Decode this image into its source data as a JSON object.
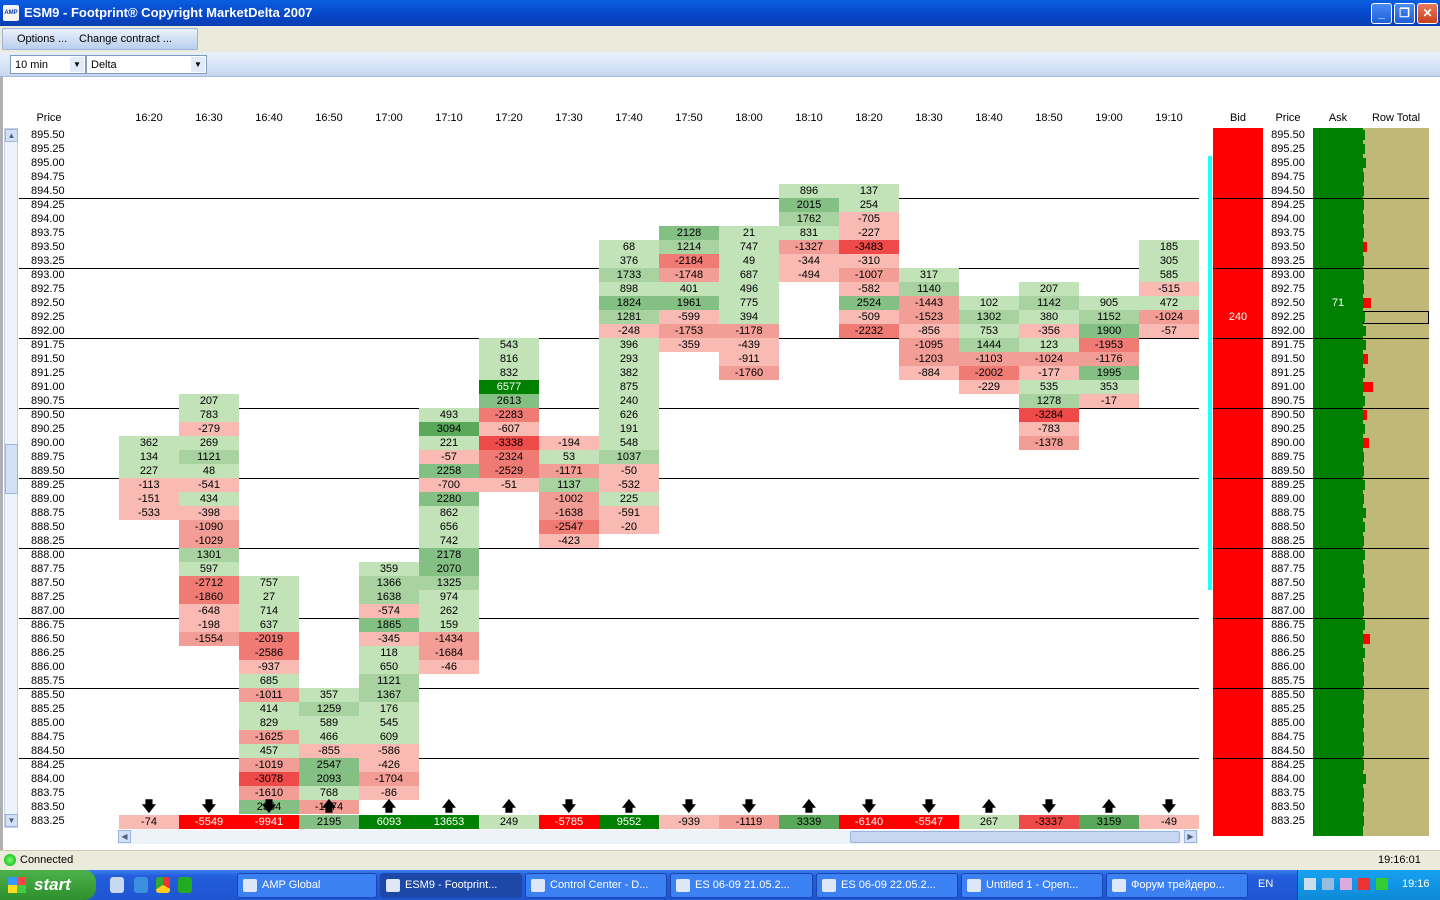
{
  "window": {
    "title": "ESM9 - Footprint® Copyright MarketDelta 2007",
    "app_icon": "AMP",
    "controls": [
      "minimize-icon",
      "restore-icon",
      "close-icon"
    ]
  },
  "toolbar": {
    "options_label": "Options ...",
    "change_contract_label": "Change contract ..."
  },
  "selectors": {
    "timeframe": "10 min",
    "mode": "Delta"
  },
  "chart": {
    "price_header": "Price",
    "times": [
      "16:20",
      "16:30",
      "16:40",
      "16:50",
      "17:00",
      "17:10",
      "17:20",
      "17:30",
      "17:40",
      "17:50",
      "18:00",
      "18:10",
      "18:20",
      "18:30",
      "18:40",
      "18:50",
      "19:00",
      "19:10"
    ],
    "prices": [
      "895.50",
      "895.25",
      "895.00",
      "894.75",
      "894.50",
      "894.25",
      "894.00",
      "893.75",
      "893.50",
      "893.25",
      "893.00",
      "892.75",
      "892.50",
      "892.25",
      "892.00",
      "891.75",
      "891.50",
      "891.25",
      "891.00",
      "890.75",
      "890.50",
      "890.25",
      "890.00",
      "889.75",
      "889.50",
      "889.25",
      "889.00",
      "888.75",
      "888.50",
      "888.25",
      "888.00",
      "887.75",
      "887.50",
      "887.25",
      "887.00",
      "886.75",
      "886.50",
      "886.25",
      "886.00",
      "885.75",
      "885.50",
      "885.25",
      "885.00",
      "884.75",
      "884.50",
      "884.25",
      "884.00",
      "883.75",
      "883.50",
      "883.25"
    ],
    "columns": [
      {
        "start": "890.00",
        "cells": [
          "362",
          "134",
          "227",
          "-113",
          "-151",
          "-533"
        ]
      },
      {
        "start": "890.75",
        "cells": [
          "207",
          "783",
          "-279",
          "269",
          "1121",
          "48",
          "-541",
          "434",
          "-398",
          "-1090",
          "-1029",
          "1301",
          "597",
          "-2712",
          "-1860",
          "-648",
          "-198",
          "-1554"
        ]
      },
      {
        "start": "887.50",
        "cells": [
          "757",
          "27",
          "714",
          "637",
          "-2019",
          "-2586",
          "-937",
          "685",
          "-1011",
          "414",
          "829",
          "-1625",
          "457",
          "-1019",
          "-3078",
          "-1610",
          "2354"
        ]
      },
      {
        "start": "885.50",
        "cells": [
          "357",
          "1259",
          "589",
          "466",
          "-855",
          "2547",
          "2093",
          "768",
          "-1674"
        ]
      },
      {
        "start": "887.75",
        "cells": [
          "359",
          "1366",
          "1638",
          "-574",
          "1865",
          "-345",
          "118",
          "650",
          "1121",
          "1367",
          "176",
          "545",
          "609",
          "-586",
          "-426",
          "-1704",
          "-86"
        ]
      },
      {
        "start": "890.50",
        "cells": [
          "493",
          "3094",
          "221",
          "-57",
          "2258",
          "-700",
          "2280",
          "862",
          "656",
          "742",
          "2178",
          "2070",
          "1325",
          "974",
          "262",
          "159",
          "-1434",
          "-1684",
          "-46"
        ]
      },
      {
        "start": "891.75",
        "cells": [
          "543",
          "816",
          "832",
          "6577",
          "2613",
          "-2283",
          "-607",
          "-3338",
          "-2324",
          "-2529",
          "-51"
        ]
      },
      {
        "start": "890.00",
        "cells": [
          "-194",
          "53",
          "-1171",
          "1137",
          "-1002",
          "-1638",
          "-2547",
          "-423"
        ]
      },
      {
        "start": "893.50",
        "cells": [
          "68",
          "376",
          "1733",
          "898",
          "1824",
          "1281",
          "-248",
          "396",
          "293",
          "382",
          "875",
          "240",
          "626",
          "191",
          "548",
          "1037",
          "-50",
          "-532",
          "225",
          "-591",
          "-20"
        ]
      },
      {
        "start": "893.75",
        "cells": [
          "2128",
          "1214",
          "-2184",
          "-1748",
          "401",
          "1961",
          "-599",
          "-1753",
          "-359"
        ]
      },
      {
        "start": "893.75",
        "cells": [
          "21",
          "747",
          "49",
          "687",
          "496",
          "775",
          "394",
          "-1178",
          "-439",
          "-911",
          "-1760"
        ]
      },
      {
        "start": "894.50",
        "cells": [
          "896",
          "2015",
          "1762",
          "831",
          "-1327",
          "-344",
          "-494"
        ]
      },
      {
        "start": "894.50",
        "cells": [
          "137",
          "254",
          "-705",
          "-227",
          "-3483",
          "-310",
          "-1007",
          "-582",
          "2524",
          "-509",
          "-2232"
        ]
      },
      {
        "start": "893.00",
        "cells": [
          "317",
          "1140",
          "-1443",
          "-1523",
          "-856",
          "-1095",
          "-1203",
          "-884"
        ]
      },
      {
        "start": "892.50",
        "cells": [
          "102",
          "1302",
          "753",
          "1444",
          "-1103",
          "-2002",
          "-229"
        ]
      },
      {
        "start": "892.75",
        "cells": [
          "207",
          "1142",
          "380",
          "-356",
          "123",
          "-1024",
          "-177",
          "535",
          "1278",
          "-3284",
          "-783",
          "-1378"
        ]
      },
      {
        "start": "892.50",
        "cells": [
          "905",
          "1152",
          "1900",
          "-1953",
          "-1176",
          "1995",
          "353",
          "-17"
        ]
      },
      {
        "start": "893.50",
        "cells": [
          "185",
          "305",
          "585",
          "-515",
          "472",
          "-1024",
          "-57"
        ]
      }
    ],
    "directions": [
      "down",
      "down",
      "down",
      "up",
      "up",
      "up",
      "up",
      "down",
      "up",
      "down",
      "down",
      "up",
      "down",
      "down",
      "up",
      "down",
      "up",
      "down"
    ],
    "totals": [
      "-74",
      "-5549",
      "-9941",
      "2195",
      "6093",
      "13653",
      "249",
      "-5785",
      "9552",
      "-939",
      "-1119",
      "3339",
      "-6140",
      "-5547",
      "267",
      "-3337",
      "3159",
      "-49"
    ]
  },
  "ladder": {
    "bid_header": "Bid",
    "price_header": "Price",
    "ask_header": "Ask",
    "rowtotal_header": "Row Total",
    "bid_size": "240",
    "ask_size": "71",
    "current_price": "892.25",
    "colors": {
      "bid": "#ff0000",
      "ask": "#008000",
      "row_total": "#bfb877"
    }
  },
  "status": {
    "connection": "Connected",
    "clock": "19:16:01"
  },
  "taskbar": {
    "start_label": "start",
    "items": [
      "AMP Global",
      "ESM9 - Footprint...",
      "Control Center - D...",
      "ES 06-09  21.05.2...",
      "ES 06-09  22.05.2...",
      "Untitled 1 - Open...",
      "Форум трейдеро..."
    ],
    "lang": "EN",
    "clock": "19:16"
  }
}
